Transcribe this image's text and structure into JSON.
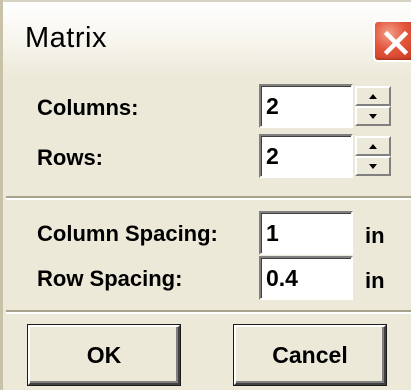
{
  "window": {
    "title": "Matrix",
    "close_icon": "close-x-icon",
    "close_color": "#d9462b"
  },
  "grid": {
    "columns_label": "Columns:",
    "columns_value": "2",
    "rows_label": "Rows:",
    "rows_value": "2",
    "spin_up_icon": "up-arrow-icon",
    "spin_down_icon": "down-arrow-icon"
  },
  "spacing": {
    "column_spacing_label": "Column Spacing:",
    "column_spacing_value": "1",
    "column_spacing_unit": "in",
    "row_spacing_label": "Row Spacing:",
    "row_spacing_value": "0.4",
    "row_spacing_unit": "in"
  },
  "buttons": {
    "ok_label": "OK",
    "cancel_label": "Cancel"
  }
}
